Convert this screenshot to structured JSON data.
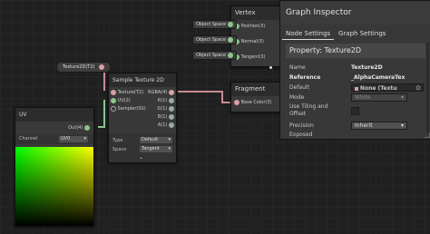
{
  "texture_node": {
    "label": "Texture2D(T2)"
  },
  "uv_node": {
    "title": "UV",
    "out_port": "Out(4)",
    "channel_label": "Channel",
    "channel_value": "UV0"
  },
  "sample_node": {
    "title": "Sample Texture 2D",
    "inputs": [
      "Texture(T2)",
      "UV(2)",
      "Sampler(SS)"
    ],
    "outputs": [
      "RGBA(4)",
      "R(1)",
      "G(1)",
      "B(1)",
      "A(1)"
    ],
    "type_label": "Type",
    "type_value": "Default",
    "space_label": "Space",
    "space_value": "Tangent"
  },
  "vertex_block": {
    "title": "Vertex",
    "spaces": [
      "Object Space",
      "Object Space",
      "Object Space"
    ],
    "ports": [
      "Position(3)",
      "Normal(3)",
      "Tangent(3)"
    ]
  },
  "fragment_block": {
    "title": "Fragment",
    "port": "Base Color(3)"
  },
  "inspector": {
    "title": "Graph Inspector",
    "tabs": [
      "Node Settings",
      "Graph Settings"
    ],
    "property_header": "Property: Texture2D",
    "rows": [
      {
        "label": "Name",
        "value": "Texture2D"
      },
      {
        "label": "Reference",
        "value": "_AlphaCameraTex"
      },
      {
        "label": "Default",
        "value": "None (Textu"
      },
      {
        "label": "Mode",
        "value": "White"
      },
      {
        "label": "Use Tiling and Offset",
        "value": ""
      },
      {
        "label": "Precision",
        "value": "Inherit"
      },
      {
        "label": "Exposed",
        "value": ""
      }
    ]
  }
}
